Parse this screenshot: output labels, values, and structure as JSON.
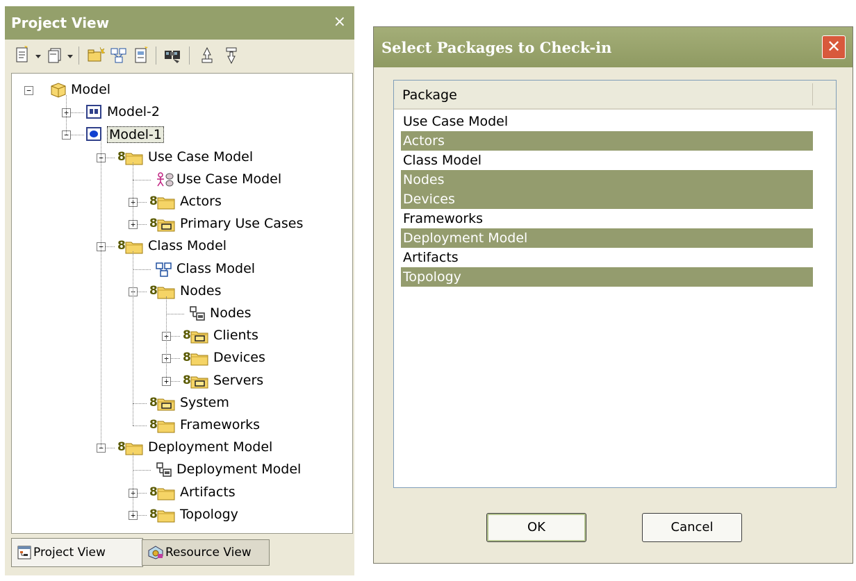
{
  "project_view": {
    "title": "Project View",
    "close": "×",
    "tree": [
      {
        "label": "Model",
        "depth": 0,
        "expander": "minus",
        "icon": "model-package-icon"
      },
      {
        "label": "Model-2",
        "depth": 1,
        "expander": "plus",
        "icon": "model-icon"
      },
      {
        "label": "Model-1",
        "depth": 1,
        "expander": "minus",
        "icon": "model-selected-icon",
        "selected": true
      },
      {
        "label": "Use Case Model",
        "depth": 2,
        "expander": "minus",
        "icon": "package-folder-icon"
      },
      {
        "label": "Use Case Model",
        "depth": 3,
        "expander": "none",
        "icon": "use-case-diagram-icon"
      },
      {
        "label": "Actors",
        "depth": 3,
        "expander": "plus",
        "icon": "package-folder-icon"
      },
      {
        "label": "Primary Use Cases",
        "depth": 3,
        "expander": "plus",
        "icon": "subsystem-folder-icon"
      },
      {
        "label": "Class Model",
        "depth": 2,
        "expander": "minus",
        "icon": "package-folder-icon"
      },
      {
        "label": "Class Model",
        "depth": 3,
        "expander": "none",
        "icon": "class-diagram-icon"
      },
      {
        "label": "Nodes",
        "depth": 3,
        "expander": "minus",
        "icon": "package-folder-icon"
      },
      {
        "label": "Nodes",
        "depth": 4,
        "expander": "none",
        "icon": "deployment-diagram-icon"
      },
      {
        "label": "Clients",
        "depth": 4,
        "expander": "plus",
        "icon": "subsystem-folder-icon"
      },
      {
        "label": "Devices",
        "depth": 4,
        "expander": "plus",
        "icon": "package-folder-icon"
      },
      {
        "label": "Servers",
        "depth": 4,
        "expander": "plus",
        "icon": "subsystem-folder-icon"
      },
      {
        "label": "System",
        "depth": 3,
        "expander": "none",
        "icon": "subsystem-folder-icon"
      },
      {
        "label": "Frameworks",
        "depth": 3,
        "expander": "none",
        "icon": "package-folder-icon"
      },
      {
        "label": "Deployment Model",
        "depth": 2,
        "expander": "minus",
        "icon": "package-folder-icon"
      },
      {
        "label": "Deployment Model",
        "depth": 3,
        "expander": "none",
        "icon": "deployment-diagram-icon"
      },
      {
        "label": "Artifacts",
        "depth": 3,
        "expander": "plus",
        "icon": "package-folder-icon"
      },
      {
        "label": "Topology",
        "depth": 3,
        "expander": "plus",
        "icon": "package-folder-icon"
      }
    ],
    "tabs": [
      {
        "label": "Project View",
        "icon": "project-view-icon",
        "active": true
      },
      {
        "label": "Resource View",
        "icon": "resource-view-icon",
        "active": false
      }
    ]
  },
  "dialog": {
    "title": "Select Packages to Check-in",
    "close": "✕",
    "column_header": "Package",
    "rows": [
      {
        "label": "Use Case Model",
        "selected": false
      },
      {
        "label": "Actors",
        "selected": true
      },
      {
        "label": "Class Model",
        "selected": false
      },
      {
        "label": "Nodes",
        "selected": true
      },
      {
        "label": "Devices",
        "selected": true
      },
      {
        "label": "Frameworks",
        "selected": false
      },
      {
        "label": "Deployment Model",
        "selected": true
      },
      {
        "label": "Artifacts",
        "selected": false
      },
      {
        "label": "Topology",
        "selected": true
      }
    ],
    "ok_label": "OK",
    "cancel_label": "Cancel"
  },
  "colors": {
    "title_bar": "#94a06b",
    "selection": "#949c6e",
    "folder": "#f5d466",
    "close_button": "#d8593c"
  }
}
